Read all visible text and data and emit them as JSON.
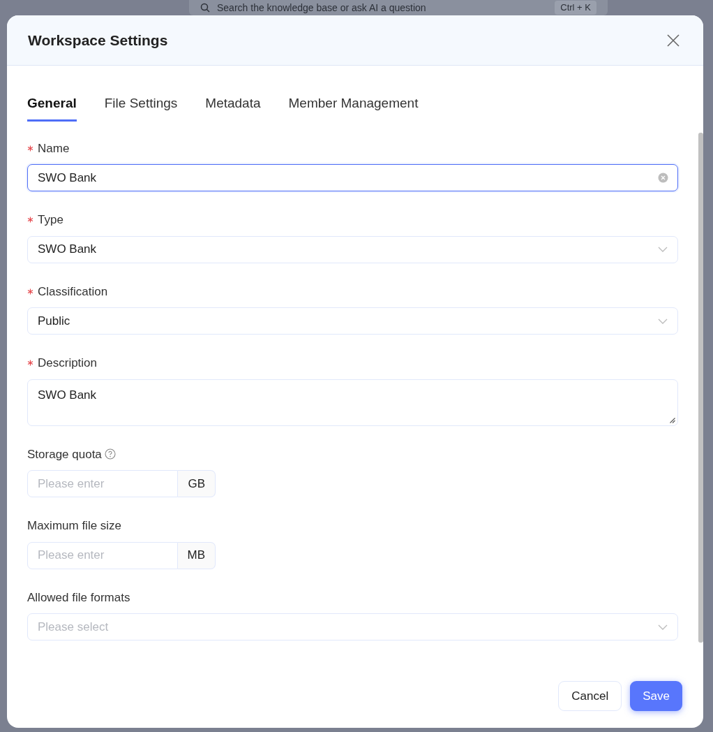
{
  "backdrop": {
    "search_placeholder": "Search the knowledge base or ask AI a question",
    "shortcut": "Ctrl + K"
  },
  "dialog": {
    "title": "Workspace Settings"
  },
  "tabs": [
    {
      "label": "General",
      "selected": true
    },
    {
      "label": "File Settings",
      "selected": false
    },
    {
      "label": "Metadata",
      "selected": false
    },
    {
      "label": "Member Management",
      "selected": false
    }
  ],
  "fields": [
    {
      "kind": "text",
      "label": "Name",
      "required": true,
      "help": false,
      "focused": true,
      "value": "SWO Bank"
    },
    {
      "kind": "select",
      "label": "Type",
      "required": true,
      "help": false,
      "focused": false,
      "value": "SWO Bank"
    },
    {
      "kind": "select",
      "label": "Classification",
      "required": true,
      "help": false,
      "focused": false,
      "value": "Public"
    },
    {
      "kind": "textarea",
      "label": "Description",
      "required": true,
      "help": false,
      "focused": false,
      "value": "SWO Bank"
    },
    {
      "kind": "addon",
      "label": "Storage quota",
      "required": false,
      "help": true,
      "focused": false,
      "placeholder": "Please enter",
      "unit": "GB"
    },
    {
      "kind": "addon",
      "label": "Maximum file size",
      "required": false,
      "help": false,
      "focused": false,
      "placeholder": "Please enter",
      "unit": "MB"
    },
    {
      "kind": "select",
      "label": "Allowed file formats",
      "required": false,
      "help": false,
      "focused": false,
      "placeholder": "Please select"
    }
  ],
  "buttons": [
    {
      "label": "Cancel",
      "kind": "secondary"
    },
    {
      "label": "Save",
      "kind": "primary"
    }
  ]
}
